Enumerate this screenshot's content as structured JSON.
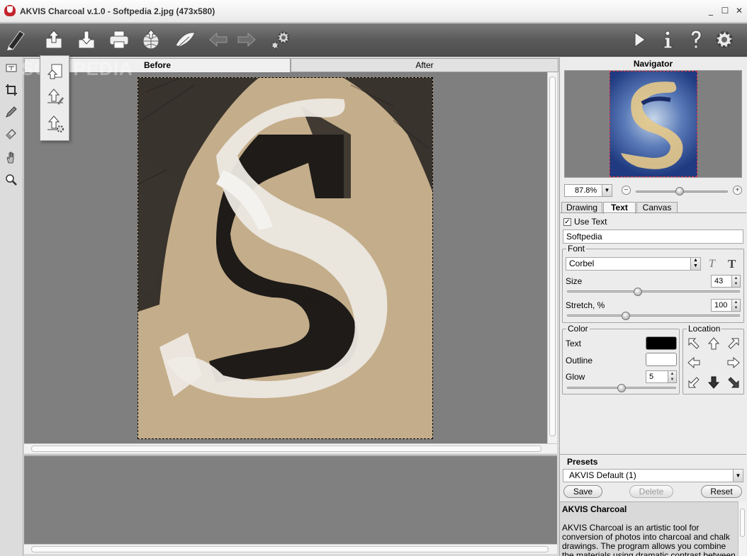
{
  "window": {
    "title": "AKVIS Charcoal v.1.0 - Softpedia 2.jpg (473x580)",
    "minimize": "_",
    "maximize": "☐",
    "close": "✕"
  },
  "toolbar": {
    "items": [
      "logo-brush-icon",
      "upload-icon",
      "download-icon",
      "print-icon",
      "share-icon",
      "feather-icon",
      "undo-arrow-icon",
      "redo-arrow-icon",
      "gear-small-icon",
      "run-icon",
      "info-icon",
      "help-icon",
      "settings-icon"
    ]
  },
  "tabs": {
    "before": "Before",
    "after": "After"
  },
  "navigator": {
    "title": "Navigator",
    "zoom_value": "87.8%",
    "zoom_minus": "−",
    "zoom_plus": "+",
    "zoom_level": 0.48
  },
  "settings_tabs": {
    "drawing": "Drawing",
    "text": "Text",
    "canvas": "Canvas"
  },
  "text_settings": {
    "use_text_label": "Use Text",
    "use_text_checked": "✓",
    "text_value": "Softpedia",
    "font_legend": "Font",
    "font_value": "Corbel",
    "italic_glyph": "T",
    "bold_glyph": "T",
    "size_label": "Size",
    "size_value": "43",
    "stretch_label": "Stretch, %",
    "stretch_value": "100",
    "color_legend": "Color",
    "text_color_label": "Text",
    "outline_color_label": "Outline",
    "glow_label": "Glow",
    "glow_value": "5",
    "location_legend": "Location",
    "text_color": "#000000",
    "outline_color": "#ffffff"
  },
  "presets": {
    "title": "Presets",
    "selected": "AKVIS Default (1)",
    "save": "Save",
    "delete": "Delete",
    "reset": "Reset"
  },
  "help": {
    "title": "AKVIS Charcoal",
    "body": "AKVIS Charcoal is an artistic tool for conversion of photos into charcoal and chalk drawings. The program allows you combine the materials using dramatic contrast between black and white."
  },
  "watermark": "SOFTPEDIA"
}
